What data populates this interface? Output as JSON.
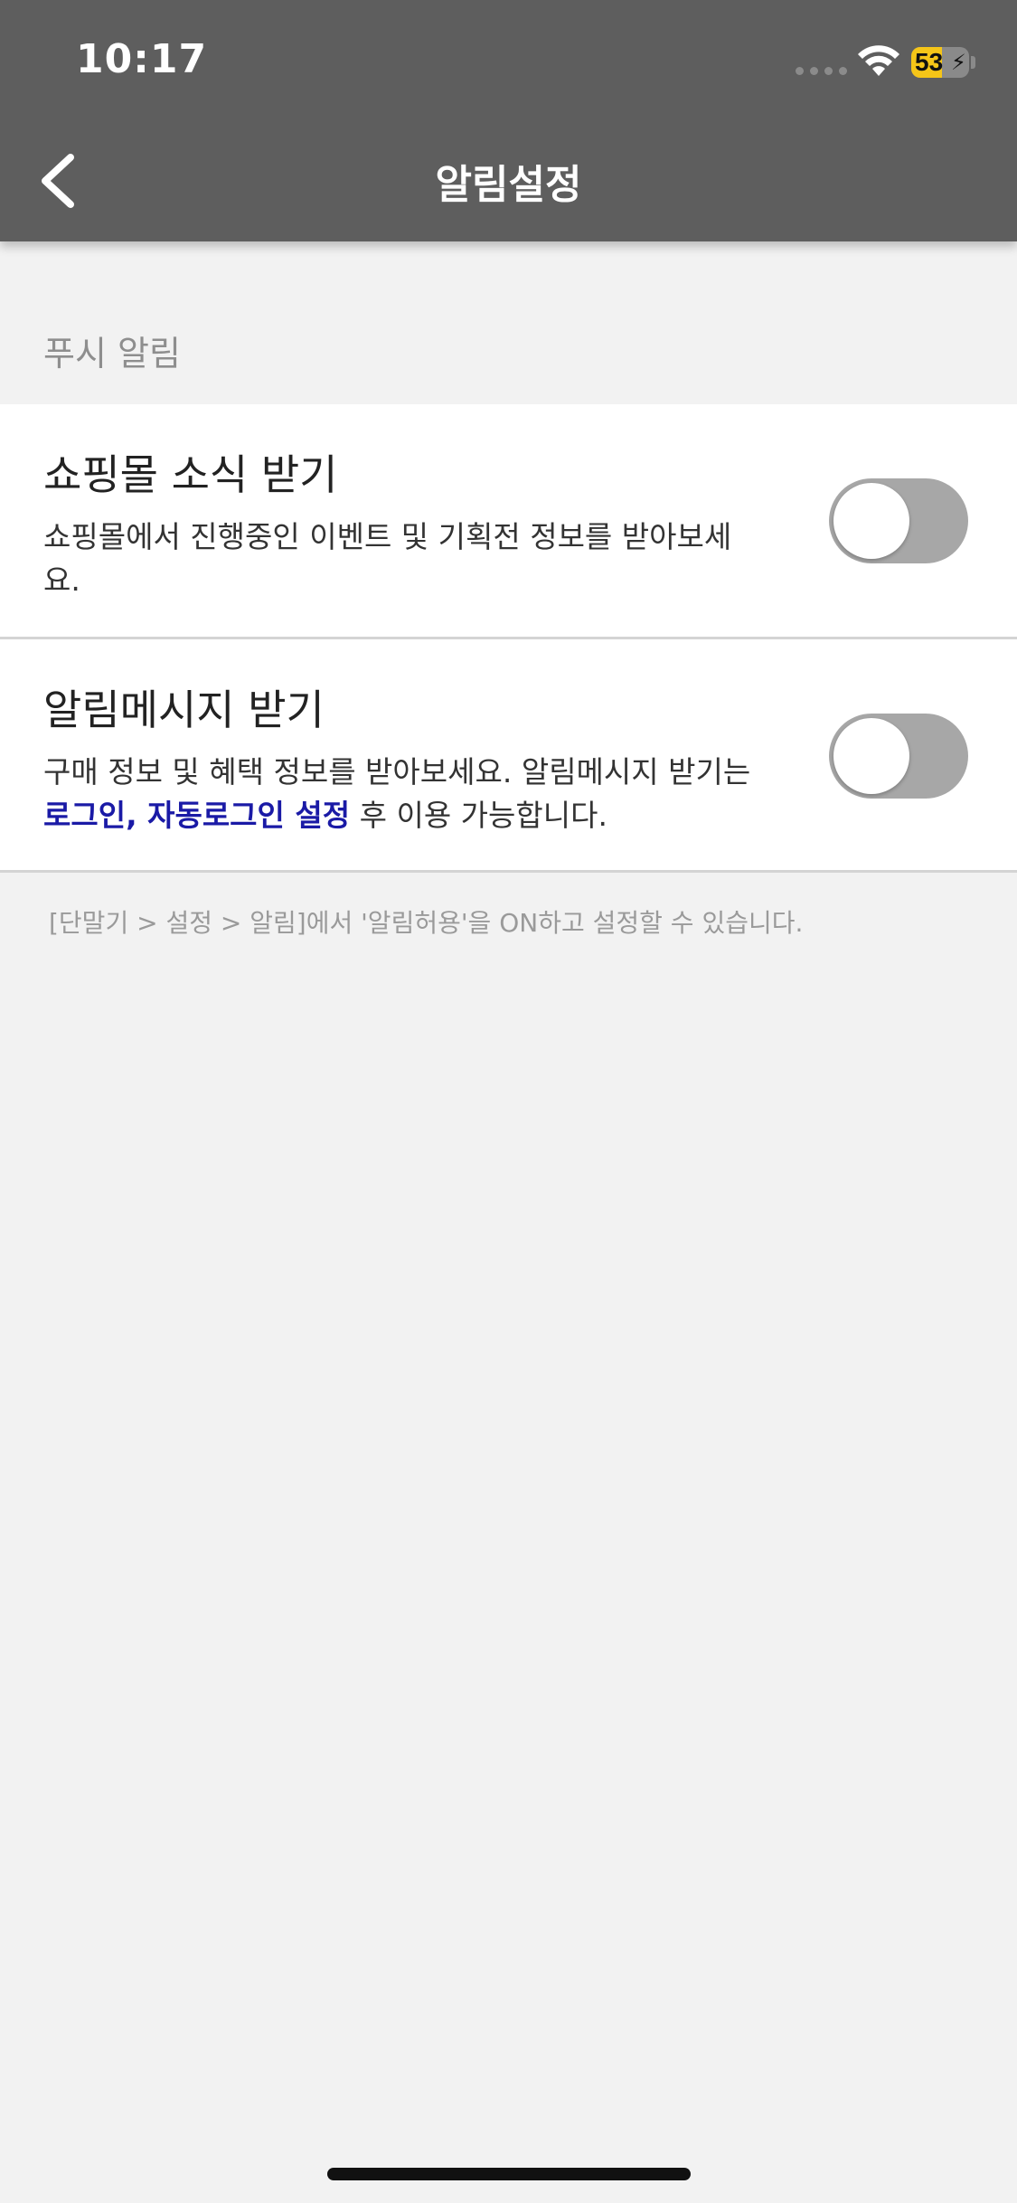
{
  "status_bar": {
    "time": "10:17",
    "battery_level": "53",
    "battery_fraction": 0.53
  },
  "nav": {
    "title": "알림설정",
    "back_icon": "chevron-left-icon"
  },
  "section": {
    "header": "푸시 알림"
  },
  "settings": [
    {
      "title": "쇼핑몰 소식 받기",
      "description": "쇼핑몰에서 진행중인 이벤트 및 기획전 정보를 받아보세요.",
      "enabled": false
    },
    {
      "title": "알림메시지 받기",
      "description_prefix": "구매 정보 및 혜택 정보를 받아보세요. 알림메시지 받기는",
      "description_link": "로그인, 자동로그인 설정",
      "description_suffix": " 후 이용 가능합니다.",
      "enabled": false
    }
  ],
  "footnote": "[단말기 > 설정 > 알림]에서 '알림허용'을 ON하고 설정할 수 있습니다.",
  "colors": {
    "header_bg": "#5e5e5e",
    "page_bg": "#f2f2f2",
    "link": "#1a1aa6",
    "toggle_off": "#a7a7a7",
    "battery": "#f5c518"
  }
}
